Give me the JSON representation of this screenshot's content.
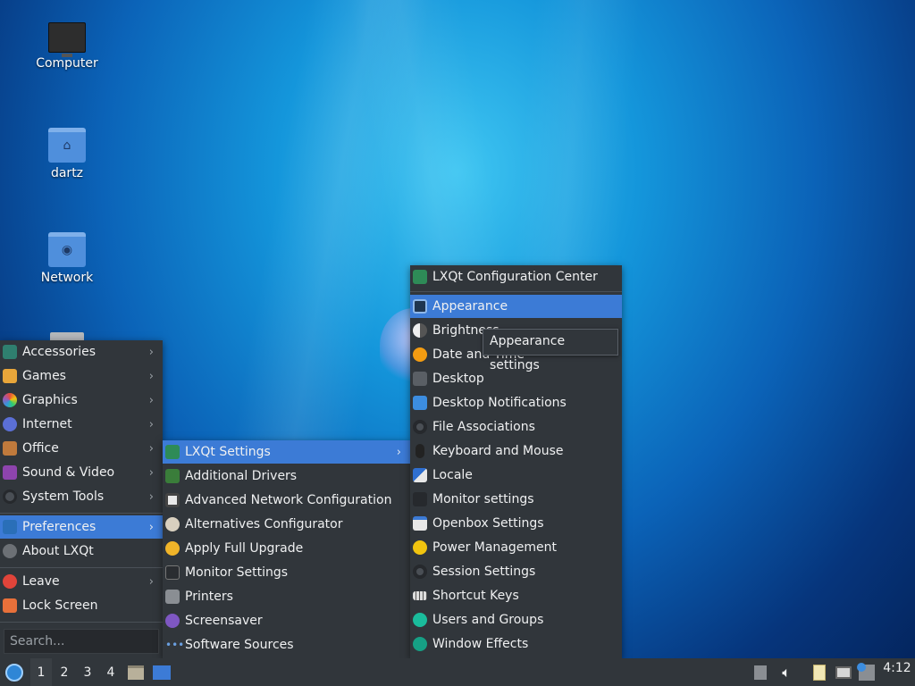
{
  "desktop": {
    "icons": [
      {
        "label": "Computer",
        "icon": "computer-icon"
      },
      {
        "label": "dartz",
        "icon": "home-folder-icon"
      },
      {
        "label": "Network",
        "icon": "network-folder-icon"
      }
    ]
  },
  "main_menu": {
    "items": [
      {
        "label": "Accessories",
        "icon": "accessories-icon",
        "submenu": true
      },
      {
        "label": "Games",
        "icon": "games-icon",
        "submenu": true
      },
      {
        "label": "Graphics",
        "icon": "graphics-icon",
        "submenu": true
      },
      {
        "label": "Internet",
        "icon": "internet-icon",
        "submenu": true
      },
      {
        "label": "Office",
        "icon": "office-icon",
        "submenu": true
      },
      {
        "label": "Sound & Video",
        "icon": "sound-video-icon",
        "submenu": true
      },
      {
        "label": "System Tools",
        "icon": "system-tools-icon",
        "submenu": true
      },
      {
        "label": "Preferences",
        "icon": "preferences-icon",
        "submenu": true,
        "selected": true
      },
      {
        "label": "About LXQt",
        "icon": "info-icon",
        "submenu": false
      },
      {
        "label": "Leave",
        "icon": "power-icon",
        "submenu": true
      },
      {
        "label": "Lock Screen",
        "icon": "lock-icon",
        "submenu": false
      }
    ],
    "search_placeholder": "Search..."
  },
  "preferences_menu": {
    "items": [
      {
        "label": "LXQt Settings",
        "icon": "lxqt-icon",
        "submenu": true,
        "selected": true
      },
      {
        "label": "Additional Drivers",
        "icon": "chip-icon"
      },
      {
        "label": "Advanced Network Configuration",
        "icon": "network-config-icon"
      },
      {
        "label": "Alternatives Configurator",
        "icon": "alternatives-icon"
      },
      {
        "label": "Apply Full Upgrade",
        "icon": "upgrade-icon"
      },
      {
        "label": "Monitor Settings",
        "icon": "monitor-icon"
      },
      {
        "label": "Printers",
        "icon": "printer-icon"
      },
      {
        "label": "Screensaver",
        "icon": "screensaver-icon"
      },
      {
        "label": "Software Sources",
        "icon": "software-sources-icon"
      }
    ]
  },
  "lxqt_settings_menu": {
    "items": [
      {
        "label": "LXQt Configuration Center",
        "icon": "lxqt-icon"
      },
      {
        "label": "Appearance",
        "icon": "appearance-icon",
        "selected": true
      },
      {
        "label": "Brightness",
        "icon": "brightness-icon"
      },
      {
        "label": "Date and Time",
        "icon": "clock-icon"
      },
      {
        "label": "Desktop",
        "icon": "desktop-icon"
      },
      {
        "label": "Desktop Notifications",
        "icon": "notifications-icon"
      },
      {
        "label": "File Associations",
        "icon": "file-associations-icon"
      },
      {
        "label": "Keyboard and Mouse",
        "icon": "mouse-icon"
      },
      {
        "label": "Locale",
        "icon": "locale-icon"
      },
      {
        "label": "Monitor settings",
        "icon": "monitor-icon"
      },
      {
        "label": "Openbox Settings",
        "icon": "openbox-icon"
      },
      {
        "label": "Power Management",
        "icon": "power-management-icon"
      },
      {
        "label": "Session Settings",
        "icon": "session-icon"
      },
      {
        "label": "Shortcut Keys",
        "icon": "keyboard-icon"
      },
      {
        "label": "Users and Groups",
        "icon": "users-icon"
      },
      {
        "label": "Window Effects",
        "icon": "window-effects-icon"
      }
    ]
  },
  "tooltip": {
    "text": "Appearance settings"
  },
  "taskbar": {
    "desktops": [
      "1",
      "2",
      "3",
      "4"
    ],
    "active_desktop": "1",
    "clock": "4:12"
  },
  "colors": {
    "menu_bg": "#31363b",
    "selection": "#3c7bd6",
    "text": "#eff0f1"
  }
}
